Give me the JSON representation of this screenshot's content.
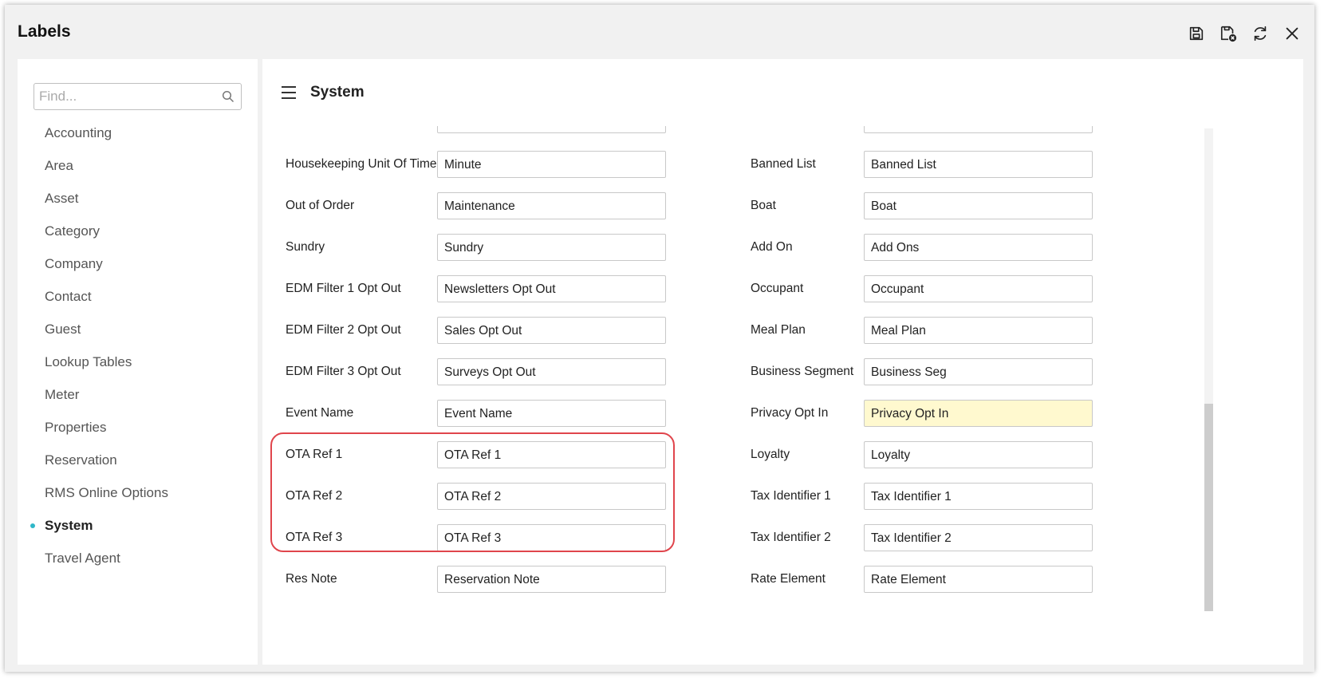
{
  "window": {
    "title": "Labels"
  },
  "toolbar": {
    "save_icon": "save-icon",
    "save_close_icon": "save-close-icon",
    "refresh_icon": "refresh-icon",
    "close_icon": "close-icon"
  },
  "sidebar": {
    "search": {
      "placeholder": "Find...",
      "value": ""
    },
    "items": [
      {
        "label": "Accounting"
      },
      {
        "label": "Area"
      },
      {
        "label": "Asset"
      },
      {
        "label": "Category"
      },
      {
        "label": "Company"
      },
      {
        "label": "Contact"
      },
      {
        "label": "Guest"
      },
      {
        "label": "Lookup Tables"
      },
      {
        "label": "Meter"
      },
      {
        "label": "Properties"
      },
      {
        "label": "Reservation"
      },
      {
        "label": "RMS Online Options"
      },
      {
        "label": "System",
        "active": true
      },
      {
        "label": "Travel Agent"
      }
    ],
    "active_dot_color": "#2fb7c8"
  },
  "main": {
    "section_title": "System",
    "rows": [
      {
        "left_label": "Housekeeping Unit Of Time",
        "left_value": "Minute",
        "right_label": "Banned List",
        "right_value": "Banned List"
      },
      {
        "left_label": "Out of Order",
        "left_value": "Maintenance",
        "right_label": "Boat",
        "right_value": "Boat"
      },
      {
        "left_label": "Sundry",
        "left_value": "Sundry",
        "right_label": "Add On",
        "right_value": "Add Ons"
      },
      {
        "left_label": "EDM Filter 1 Opt Out",
        "left_value": "Newsletters Opt Out",
        "right_label": "Occupant",
        "right_value": "Occupant"
      },
      {
        "left_label": "EDM Filter 2 Opt Out",
        "left_value": "Sales Opt Out",
        "right_label": "Meal Plan",
        "right_value": "Meal Plan"
      },
      {
        "left_label": "EDM Filter 3 Opt Out",
        "left_value": "Surveys Opt Out",
        "right_label": "Business Segment",
        "right_value": "Business Seg"
      },
      {
        "left_label": "Event Name",
        "left_value": "Event Name",
        "right_label": "Privacy Opt In",
        "right_value": "Privacy Opt In"
      },
      {
        "left_label": "OTA Ref 1",
        "left_value": "OTA Ref 1",
        "right_label": "Loyalty",
        "right_value": "Loyalty"
      },
      {
        "left_label": "OTA Ref 2",
        "left_value": "OTA Ref 2",
        "right_label": "Tax Identifier 1",
        "right_value": "Tax Identifier 1"
      },
      {
        "left_label": "OTA Ref 3",
        "left_value": "OTA Ref 3",
        "right_label": "Tax Identifier 2",
        "right_value": "Tax Identifier 2"
      },
      {
        "left_label": "Res Note",
        "left_value": "Reservation Note",
        "right_label": "Rate Element",
        "right_value": "Rate Element"
      }
    ],
    "highlight_color": "#fff9cf",
    "annotation_color": "#e0454c"
  }
}
